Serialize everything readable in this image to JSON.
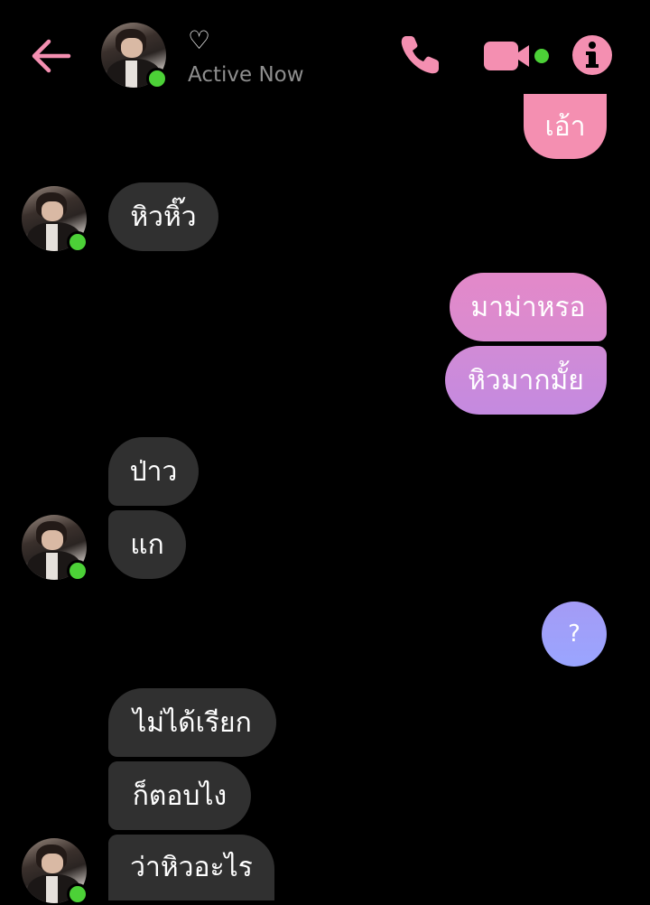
{
  "header": {
    "name": "♡",
    "status": "Active Now",
    "icons": {
      "back": "back-arrow-icon",
      "call": "phone-icon",
      "video": "video-camera-icon",
      "info": "info-icon"
    },
    "accent_color": "#f48fb1",
    "online_color": "#4cd137"
  },
  "messages": [
    {
      "sender": "me",
      "text": "เอ้า"
    },
    {
      "sender": "them",
      "text": "หิวหิ๊ว"
    },
    {
      "sender": "me",
      "text": "มาม่าหรอ"
    },
    {
      "sender": "me",
      "text": "หิวมากมั้ย"
    },
    {
      "sender": "them",
      "text": "ป่าว"
    },
    {
      "sender": "them",
      "text": "แก"
    },
    {
      "sender": "me",
      "text": "?"
    },
    {
      "sender": "them",
      "text": "ไม่ได้เรียก"
    },
    {
      "sender": "them",
      "text": "ก็ตอบไง"
    },
    {
      "sender": "them",
      "text": "ว่าหิวอะไร"
    }
  ]
}
